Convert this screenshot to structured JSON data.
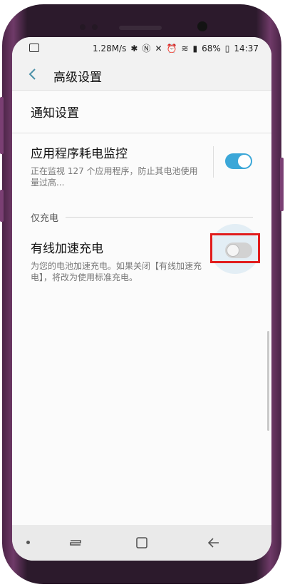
{
  "status_bar": {
    "network_speed": "1.28M/s",
    "battery": "68%",
    "time": "14:37"
  },
  "app_bar": {
    "title": "高级设置"
  },
  "list": {
    "notification_settings": "通知设置",
    "app_power_monitor": {
      "title": "应用程序耗电监控",
      "description": "正在监视 127 个应用程序，防止其电池使用量过高...",
      "enabled": true
    },
    "section_charging_only": "仅充电",
    "wired_fast_charging": {
      "title": "有线加速充电",
      "description": "为您的电池加速充电。如果关闭【有线加速充电】，将改为使用标准充电。",
      "enabled": false
    }
  },
  "colors": {
    "accent": "#3ba7d8",
    "highlight_box": "#e11d1d",
    "phone_frame": "#6f3a68"
  }
}
